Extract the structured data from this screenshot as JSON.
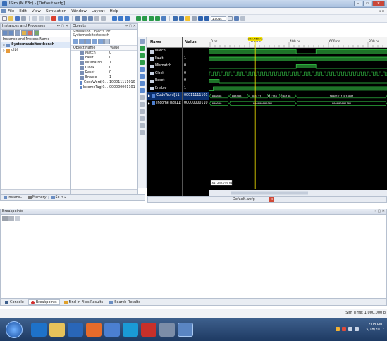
{
  "window": {
    "title": "ISim (M.63c) - [Default.wcfg]",
    "buttons": [
      "–",
      "▭",
      "✕"
    ]
  },
  "menu": {
    "items": [
      "File",
      "Edit",
      "View",
      "Simulation",
      "Window",
      "Layout",
      "Help"
    ],
    "right_controls": "– ▫ x"
  },
  "toolbar": {
    "run_time": "1.00us"
  },
  "instances": {
    "title": "Instances and Processes",
    "controls": "↔ ▢ ✕",
    "column": "Instance and Process Name",
    "items": [
      "Systemcadcltestbench",
      "glbl"
    ]
  },
  "objects": {
    "title": "Objects",
    "controls": "↔ ▢ ✕",
    "subtitle": "Simulation Objects for Systemadcltestbench",
    "columns": {
      "name": "Object Name",
      "value": "Value"
    },
    "rows": [
      {
        "name": "Match",
        "value": "0"
      },
      {
        "name": "Fault",
        "value": "0"
      },
      {
        "name": "Mismatch",
        "value": "1"
      },
      {
        "name": "Clock",
        "value": "0"
      },
      {
        "name": "Reset",
        "value": "0"
      },
      {
        "name": "Enable",
        "value": "1"
      },
      {
        "name": "CodeWord[0...",
        "value": "100011111010"
      },
      {
        "name": "IncomeTag[0...",
        "value": "000000001101"
      }
    ]
  },
  "left_tabs": [
    "Instanc...",
    "Memory",
    "So < ▸"
  ],
  "wave": {
    "headers": {
      "name": "Name",
      "value": "Value"
    },
    "signals": [
      {
        "name": "Match",
        "value": "1"
      },
      {
        "name": "Fault",
        "value": "1"
      },
      {
        "name": "Mismatch",
        "value": "0"
      },
      {
        "name": "Clock",
        "value": "0"
      },
      {
        "name": "Reset",
        "value": "0"
      },
      {
        "name": "Enable",
        "value": "1"
      },
      {
        "name": "CodeWord[11:",
        "value": "00011111101"
      },
      {
        "name": "IncomeTag[11:",
        "value": "00000000110"
      }
    ],
    "cursor_label": "232.759 ns",
    "cursor_readout": "X1: 232.759 ns",
    "time_labels": [
      "0 ns",
      "200 ns",
      "400 ns",
      "600 ns",
      "800 ns"
    ],
    "bus_segments": {
      "codeword": [
        "000000...",
        "001000...",
        "000111...",
        "111110...",
        "100100...",
        "100011111010001"
      ],
      "incometag": [
        "000000...",
        "000000001001",
        "000000001101"
      ]
    },
    "filename": "Default.wcfg",
    "close": "x"
  },
  "breakpoints": {
    "title": "Breakpoints",
    "controls": "↔ ▢ ✕"
  },
  "bottom_tabs": [
    "Console",
    "Breakpoints",
    "Find in Files Results",
    "Search Results"
  ],
  "status": {
    "sim_time": "Sim Time: 1,000,000 p"
  },
  "tray": {
    "time": "2:08 PM",
    "date": "5/18/2017"
  },
  "colors": {
    "wave_green": "#36d14a",
    "cursor_yellow": "#f5e200",
    "wave_bg": "#000000",
    "bus_text": "#ffffff"
  }
}
